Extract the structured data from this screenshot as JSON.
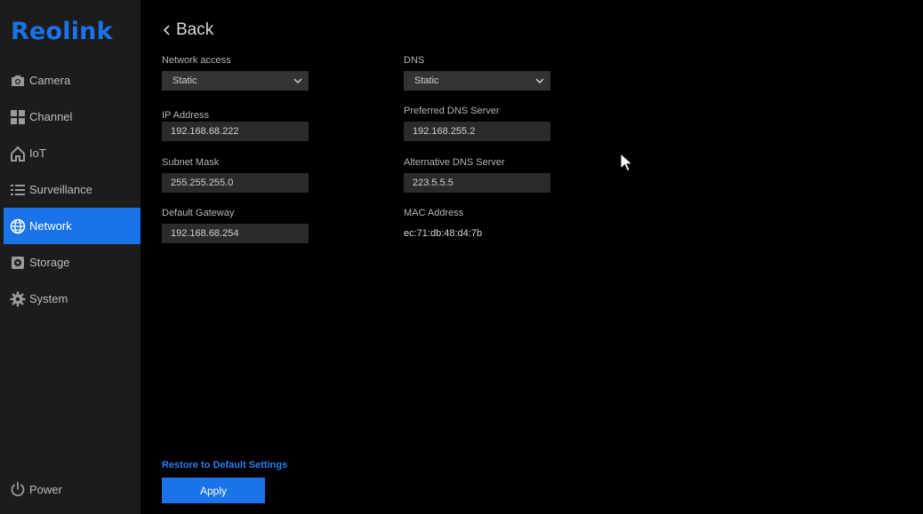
{
  "brand": {
    "logo_text": "Reolink",
    "accent": "#1a73e8"
  },
  "sidebar": {
    "items": [
      {
        "label": "Camera",
        "icon": "camera-icon"
      },
      {
        "label": "Channel",
        "icon": "grid-icon"
      },
      {
        "label": "IoT",
        "icon": "home-icon"
      },
      {
        "label": "Surveillance",
        "icon": "list-icon"
      },
      {
        "label": "Network",
        "icon": "globe-icon",
        "active": true
      },
      {
        "label": "Storage",
        "icon": "storage-icon"
      },
      {
        "label": "System",
        "icon": "gear-icon"
      }
    ],
    "power_label": "Power"
  },
  "header": {
    "back_label": "Back"
  },
  "form": {
    "network_access": {
      "label": "Network access",
      "value": "Static"
    },
    "ip_address": {
      "label": "IP Address",
      "value": "192.168.68.222"
    },
    "subnet_mask": {
      "label": "Subnet Mask",
      "value": "255.255.255.0"
    },
    "default_gateway": {
      "label": "Default Gateway",
      "value": "192.168.68.254"
    },
    "dns": {
      "label": "DNS",
      "value": "Static"
    },
    "preferred_dns": {
      "label": "Preferred DNS Server",
      "value": "192.168.255.2"
    },
    "alternative_dns": {
      "label": "Alternative DNS Server",
      "value": "223.5.5.5"
    },
    "mac_address": {
      "label": "MAC Address",
      "value": "ec:71:db:48:d4:7b"
    }
  },
  "footer": {
    "restore_label": "Restore to Default Settings",
    "apply_label": "Apply"
  }
}
